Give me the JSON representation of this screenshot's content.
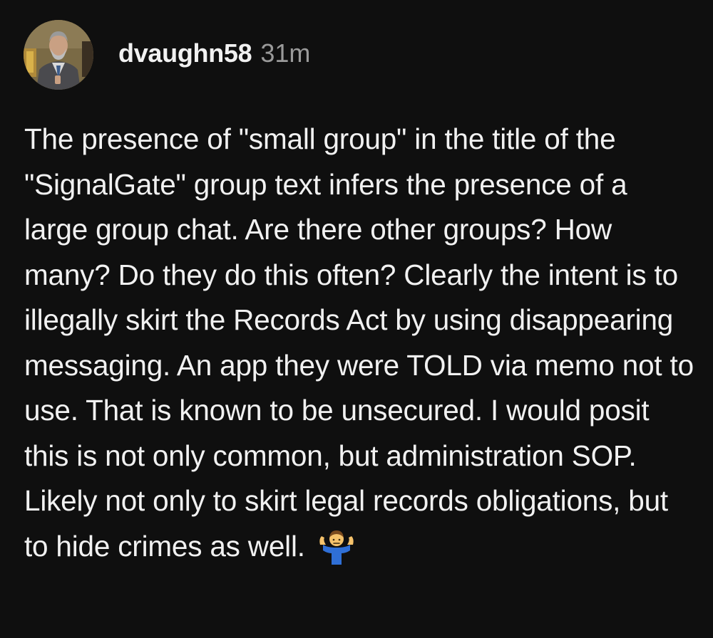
{
  "comment": {
    "username": "dvaughn58",
    "timestamp": "31m",
    "text": "The presence of \"small group\" in the title of the \"SignalGate\" group text infers the presence of a large group chat. Are there other groups? How many? Do they do this often? Clearly the intent is to illegally skirt the Records Act by using disappearing messaging. An app they were TOLD via memo not to use. That is known to be unsecured. I would posit this is not only common, but administration SOP. Likely not only to skirt legal records obligations, but to hide crimes as well.",
    "emoji_icon": "person-shrugging-icon"
  },
  "colors": {
    "background": "#0f0f0f",
    "text": "#f1f1f1",
    "timestamp": "#9a9a9a"
  }
}
